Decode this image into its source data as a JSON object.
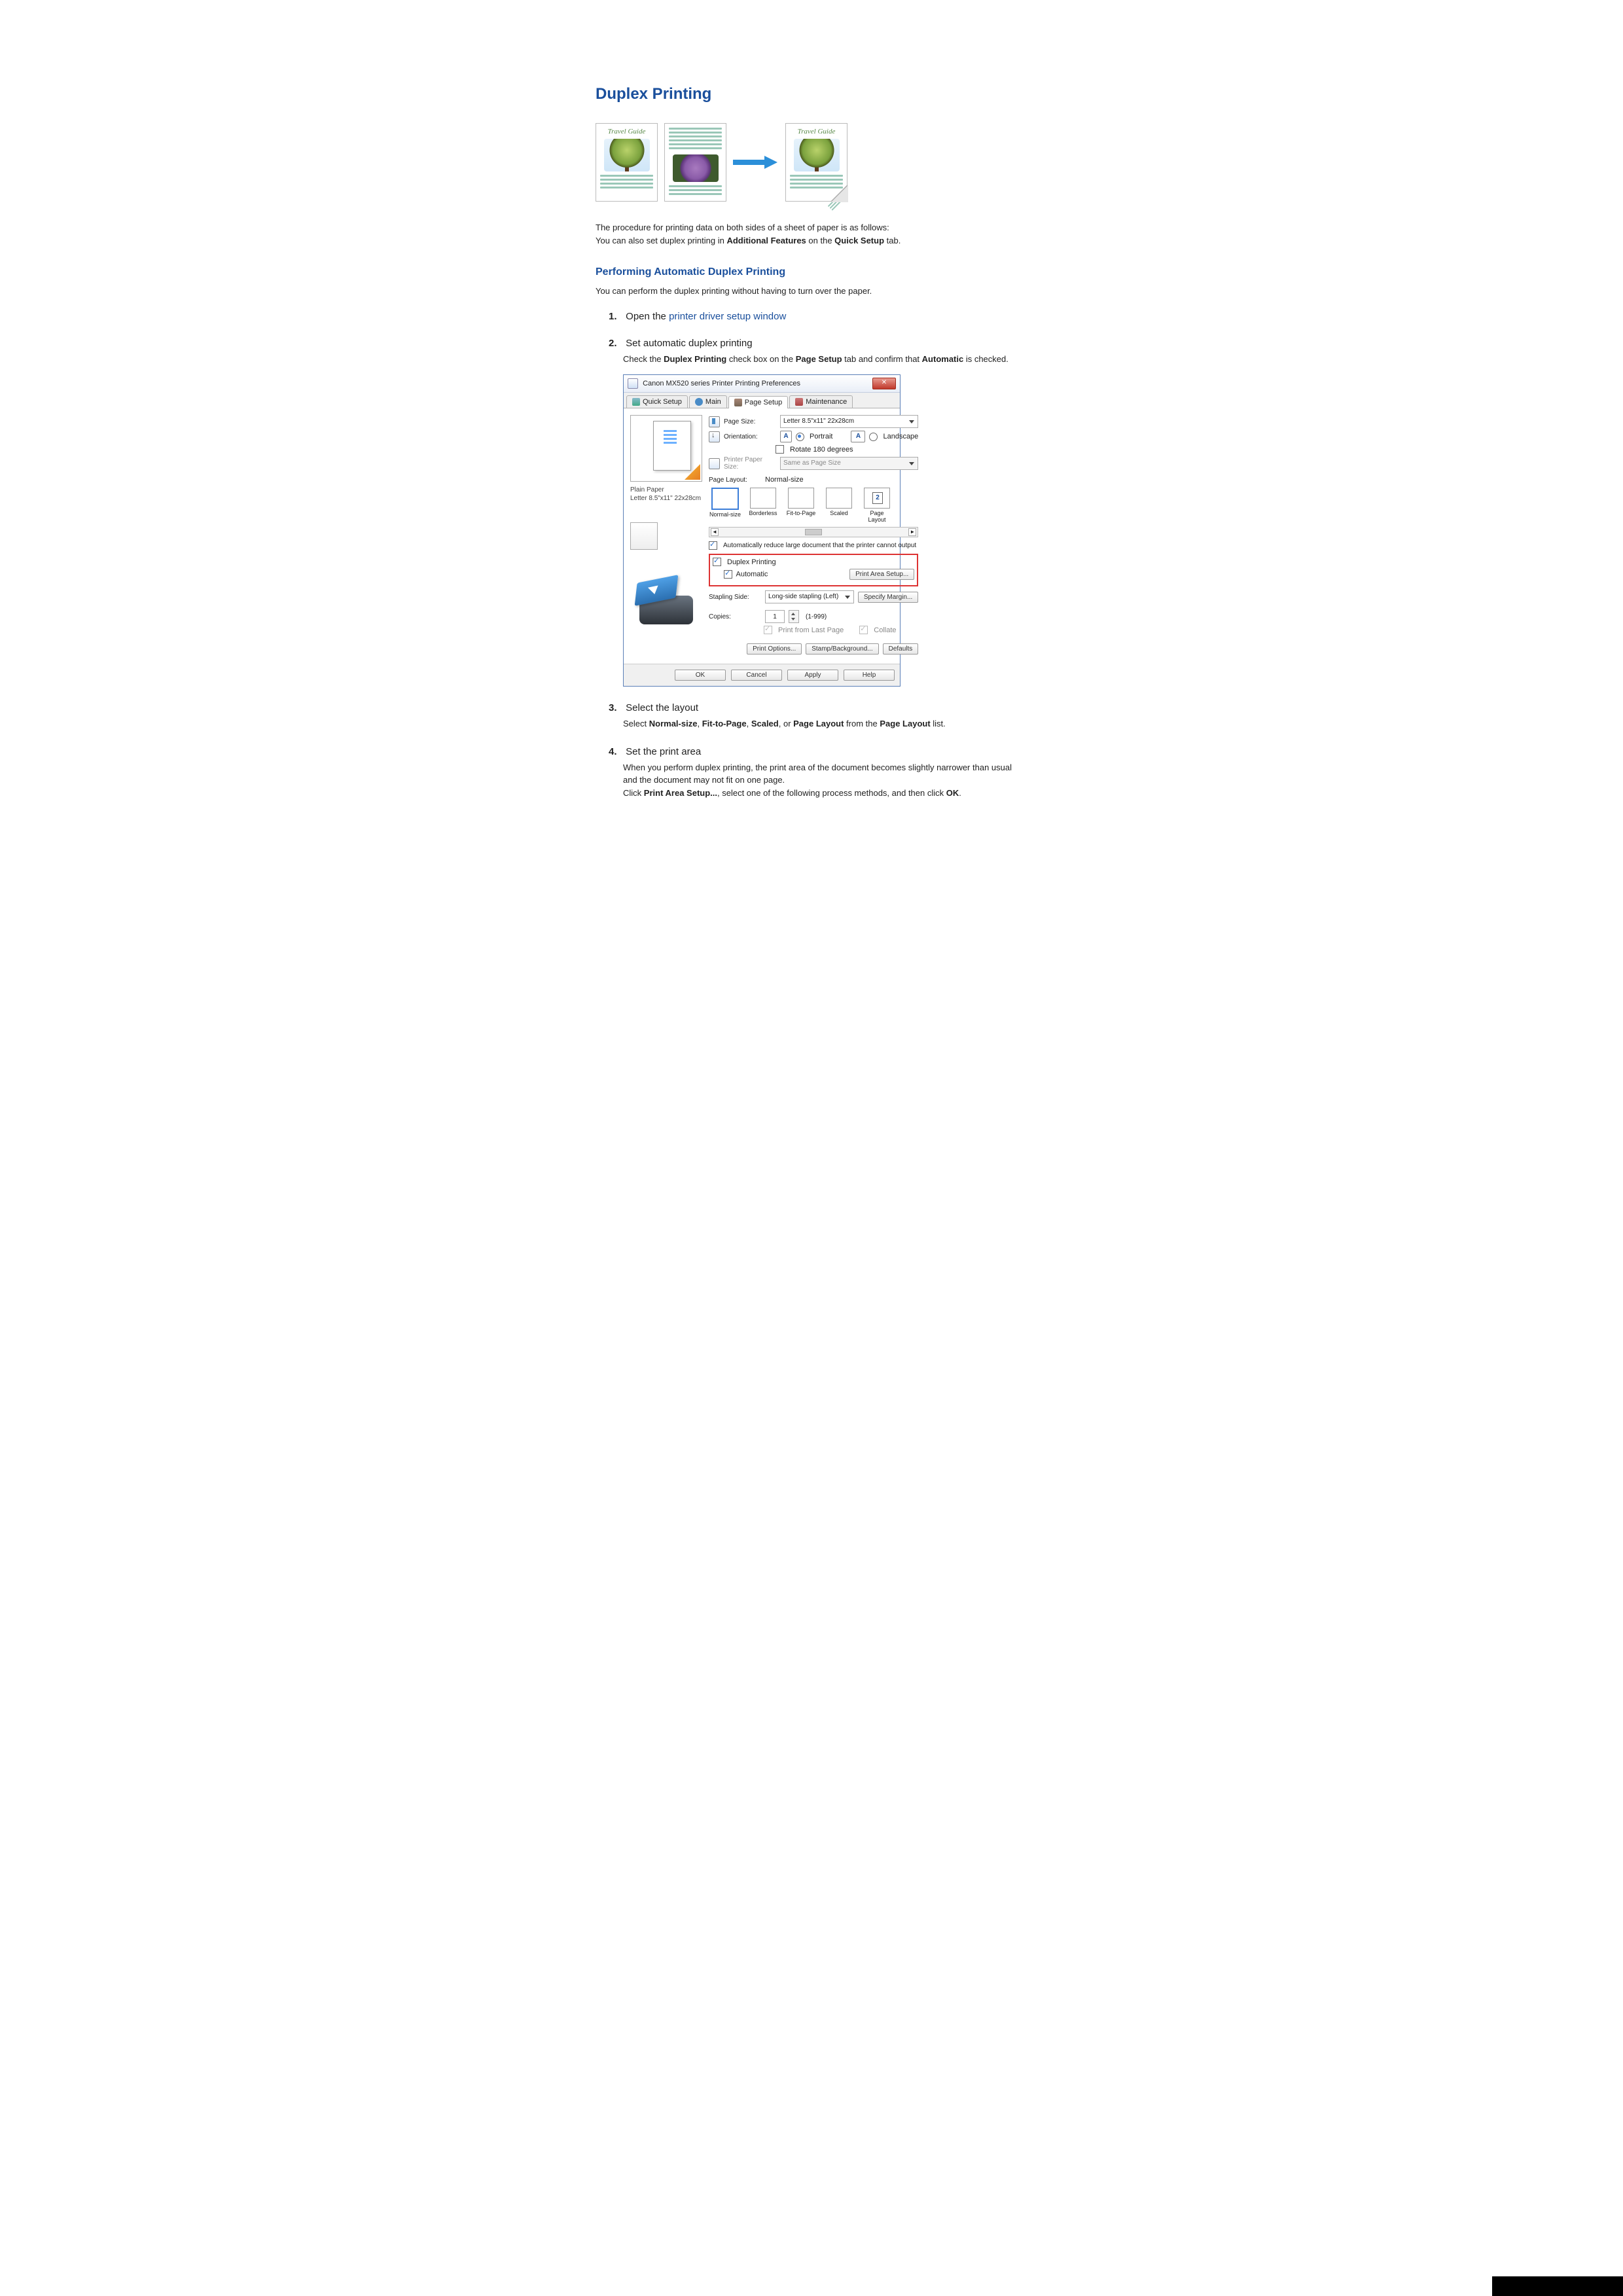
{
  "title": "Duplex Printing",
  "illustration_header": "Travel Guide",
  "intro1": "The procedure for printing data on both sides of a sheet of paper is as follows:",
  "intro2a": "You can also set duplex printing in ",
  "intro2b": "Additional Features",
  "intro2c": " on the ",
  "intro2d": "Quick Setup",
  "intro2e": " tab.",
  "section1": "Performing Automatic Duplex Printing",
  "section1_body": "You can perform the duplex printing without having to turn over the paper.",
  "steps": {
    "s1": {
      "num": "1.",
      "a": "Open the ",
      "link": "printer driver setup window"
    },
    "s2": {
      "num": "2.",
      "title": "Set automatic duplex printing",
      "sub_a": "Check the ",
      "sub_b": "Duplex Printing",
      "sub_c": " check box on the ",
      "sub_d": "Page Setup",
      "sub_e": " tab and confirm that ",
      "sub_f": "Automatic",
      "sub_g": " is checked."
    },
    "s3": {
      "num": "3.",
      "title": "Select the layout",
      "sub_a": "Select ",
      "sub_b": "Normal-size",
      "sub_c": ", ",
      "sub_d": "Fit-to-Page",
      "sub_e": ", ",
      "sub_f": "Scaled",
      "sub_g": ", or ",
      "sub_h": "Page Layout",
      "sub_i": " from the ",
      "sub_j": "Page Layout",
      "sub_k": " list."
    },
    "s4": {
      "num": "4.",
      "title": "Set the print area",
      "sub1": "When you perform duplex printing, the print area of the document becomes slightly narrower than usual and the document may not fit on one page.",
      "sub2a": "Click ",
      "sub2b": "Print Area Setup...",
      "sub2c": ", select one of the following process methods, and then click ",
      "sub2d": "OK",
      "sub2e": "."
    }
  },
  "dialog": {
    "title": "Canon MX520 series Printer Printing Preferences",
    "tabs": [
      "Quick Setup",
      "Main",
      "Page Setup",
      "Maintenance"
    ],
    "page_size_label": "Page Size:",
    "page_size_value": "Letter 8.5\"x11\" 22x28cm",
    "orientation_label": "Orientation:",
    "portrait": "Portrait",
    "landscape": "Landscape",
    "rotate": "Rotate 180 degrees",
    "printer_paper_label": "Printer Paper Size:",
    "printer_paper_value": "Same as Page Size",
    "page_layout_label": "Page Layout:",
    "page_layout_value": "Normal-size",
    "layouts": [
      "Normal-size",
      "Borderless",
      "Fit-to-Page",
      "Scaled",
      "Page Layout"
    ],
    "auto_reduce": "Automatically reduce large document that the printer cannot output",
    "duplex_printing": "Duplex Printing",
    "automatic": "Automatic",
    "print_area_setup": "Print Area Setup...",
    "stapling_label": "Stapling Side:",
    "stapling_value": "Long-side stapling (Left)",
    "specify_margin": "Specify Margin...",
    "copies_label": "Copies:",
    "copies_value": "1",
    "copies_range": "(1-999)",
    "print_from_last": "Print from Last Page",
    "collate": "Collate",
    "print_options": "Print Options...",
    "stamp_background": "Stamp/Background...",
    "defaults": "Defaults",
    "ok": "OK",
    "cancel": "Cancel",
    "apply": "Apply",
    "help": "Help",
    "preview_media": "Plain Paper",
    "preview_size": "Letter 8.5\"x11\" 22x28cm",
    "layout_num": "2"
  }
}
